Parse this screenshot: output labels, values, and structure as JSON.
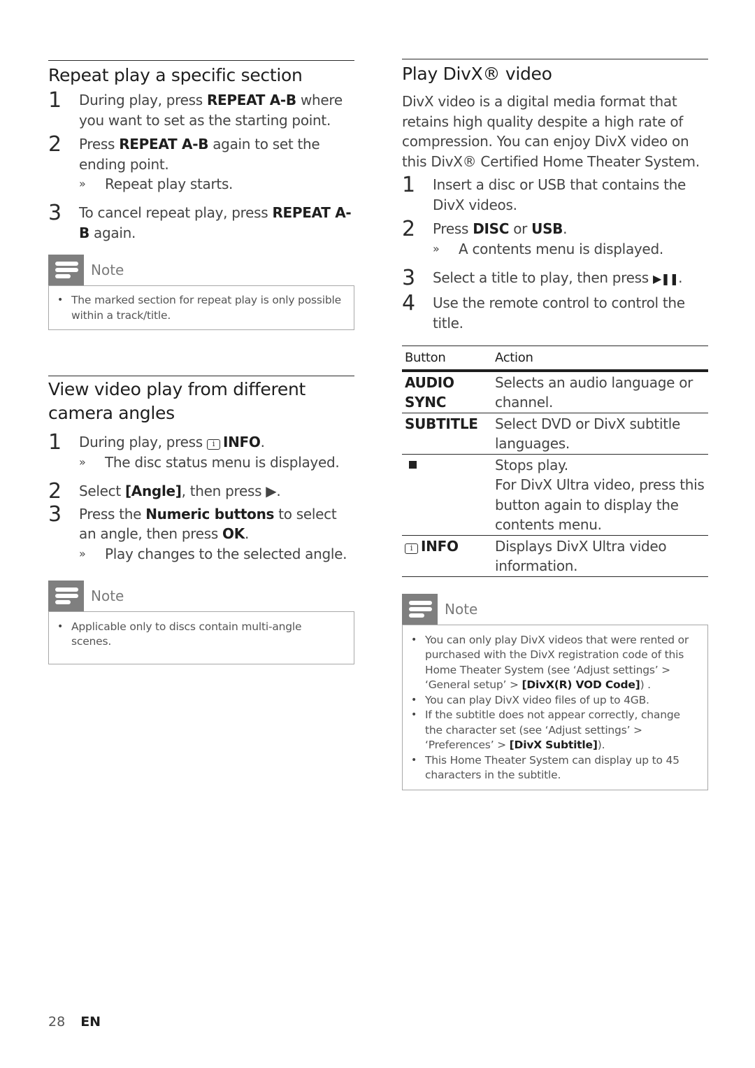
{
  "left": {
    "section1": {
      "title": "Repeat play a specific section",
      "steps": [
        {
          "num": "1",
          "pre": "During play, press ",
          "bold": "REPEAT A-B",
          "post": " where you want to set as the starting point."
        },
        {
          "num": "2",
          "pre": "Press ",
          "bold": "REPEAT A-B",
          "post": " again to set the ending point.",
          "result": "Repeat play starts."
        },
        {
          "num": "3",
          "pre": "To cancel repeat play, press ",
          "bold": "REPEAT A-B",
          "post": " again."
        }
      ],
      "note": {
        "label": "Note",
        "bullets": [
          "The marked section for repeat play is only possible within a track/title."
        ]
      }
    },
    "section2": {
      "title": "View video play from different camera angles",
      "steps": [
        {
          "num": "1",
          "pre": "During play, press ",
          "icon": "i",
          "bold": "INFO",
          "post": ".",
          "result": "The disc status menu is displayed."
        },
        {
          "num": "2",
          "pre": "Select ",
          "bold": "[Angle]",
          "post": ", then press ▶."
        },
        {
          "num": "3",
          "pre": "Press the ",
          "bold": "Numeric buttons",
          "mid": " to select an angle, then press ",
          "bold2": "OK",
          "post": ".",
          "result": "Play changes to the selected angle."
        }
      ],
      "note": {
        "label": "Note",
        "bullets": [
          "Applicable only to discs contain multi-angle scenes."
        ]
      }
    }
  },
  "right": {
    "title": "Play DivX® video",
    "intro": "DivX video is a digital media format that retains high quality despite a high rate of compression. You can enjoy DivX video on this DivX® Certified Home Theater System.",
    "steps": [
      {
        "num": "1",
        "text": "Insert a disc or USB that contains the DivX videos."
      },
      {
        "num": "2",
        "pre": "Press ",
        "bold": "DISC",
        "mid": " or ",
        "bold2": "USB",
        "post": ".",
        "result": "A contents menu is displayed."
      },
      {
        "num": "3",
        "pre": "Select a title to play, then press ",
        "glyph": "▶❚❚",
        "post": "."
      },
      {
        "num": "4",
        "text": "Use the remote control to control the title."
      }
    ],
    "table": {
      "headers": [
        "Button",
        "Action"
      ],
      "rows": [
        {
          "button": "AUDIO SYNC",
          "action": "Selects an audio language or channel."
        },
        {
          "button": "SUBTITLE",
          "action": "Select DVD or DivX subtitle languages."
        },
        {
          "button": "stop-icon",
          "action_lines": [
            "Stops play.",
            "For DivX Ultra video, press this button again to display the contents menu."
          ]
        },
        {
          "button": "INFO",
          "button_icon": "i",
          "action": "Displays DivX Ultra video information."
        }
      ]
    },
    "note": {
      "label": "Note",
      "bullets": [
        {
          "pre": "You can only play DivX videos that were rented or purchased with the DivX registration code of this Home Theater System (see ‘Adjust settings’ > ‘General setup’ > ",
          "bold": "[DivX(R) VOD Code]",
          "post": ") ."
        },
        {
          "pre": "You can play DivX video files of up to 4GB."
        },
        {
          "pre": "If the subtitle does not appear correctly, change the character set (see ‘Adjust settings’ > ‘Preferences’ > ",
          "bold": "[DivX Subtitle]",
          "post": ")."
        },
        {
          "pre": "This Home Theater System can display up to 45 characters in the subtitle."
        }
      ]
    }
  },
  "footer": {
    "page": "28",
    "lang": "EN"
  },
  "symbols": {
    "result_marker": "»",
    "bullet": "•"
  }
}
